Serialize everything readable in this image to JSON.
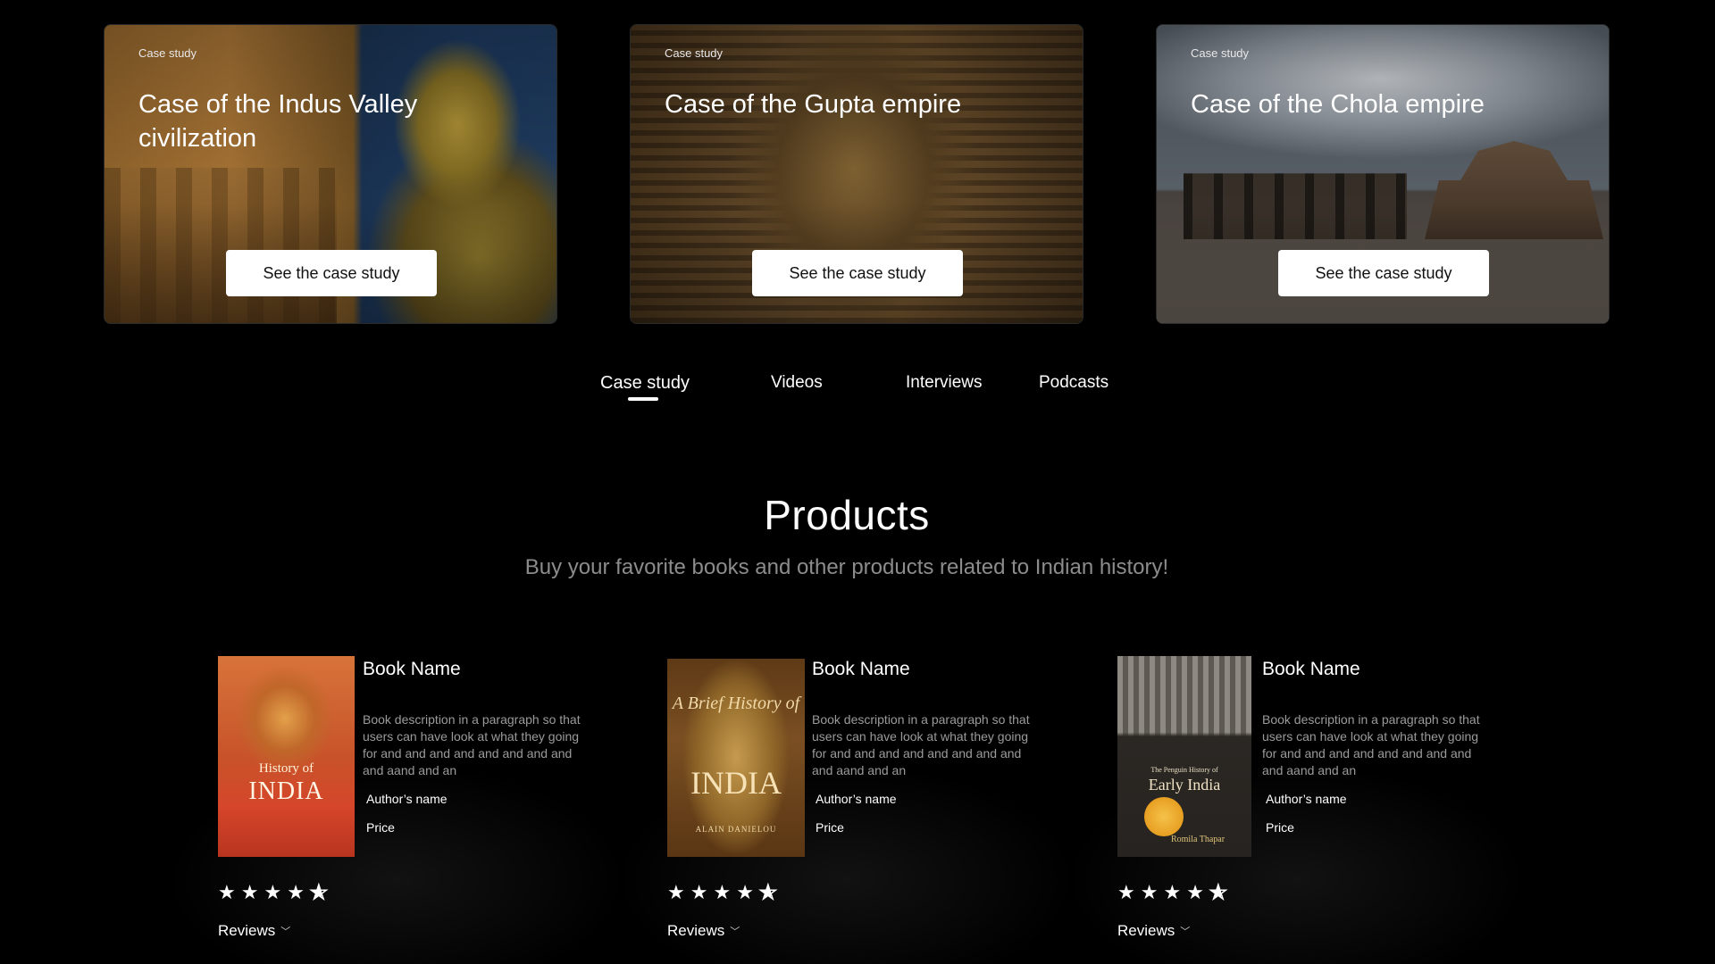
{
  "case_studies": [
    {
      "tag": "Case study",
      "title": "Case of the Indus Valley civilization",
      "cta": "See the case study"
    },
    {
      "tag": "Case study",
      "title": "Case of the Gupta empire",
      "cta": "See the case study"
    },
    {
      "tag": "Case study",
      "title": "Case of the Chola empire",
      "cta": "See the case study"
    }
  ],
  "tabs": [
    {
      "label": "Case study",
      "active": true
    },
    {
      "label": "Videos"
    },
    {
      "label": "Interviews"
    },
    {
      "label": "Podcasts"
    }
  ],
  "products": {
    "title": "Products",
    "subtitle": "Buy your favorite books and other products related to Indian history!",
    "items": [
      {
        "name": "Book Name",
        "description": "Book description in a paragraph so that users can have look at what they going for and and and and and and and and and aand and an",
        "author": "Author’s name",
        "price": "Price",
        "rating": 4.5,
        "reviews_label": "Reviews",
        "cover": {
          "line1": "History of",
          "line2": "INDIA"
        }
      },
      {
        "name": "Book Name",
        "description": "Book description in a paragraph so that users can have look at what they going for and and and and and and and and and aand and an",
        "author": "Author’s name",
        "price": "Price",
        "rating": 4.5,
        "reviews_label": "Reviews",
        "cover": {
          "line1": "A Brief History of",
          "line2": "INDIA",
          "line3": "ALAIN DANIELOU"
        }
      },
      {
        "name": "Book Name",
        "description": "Book description in a paragraph so that users can have look at what they going for and and and and and and and and and aand and an",
        "author": "Author’s name",
        "price": "Price",
        "rating": 4.5,
        "reviews_label": "Reviews",
        "cover": {
          "line1": "The Penguin History of",
          "line2": "Early India",
          "line3": "Romila Thapar"
        }
      }
    ]
  },
  "icons": {
    "star": "star-icon",
    "half_star": "star-half-icon",
    "chevron": "chevron-down-icon"
  }
}
